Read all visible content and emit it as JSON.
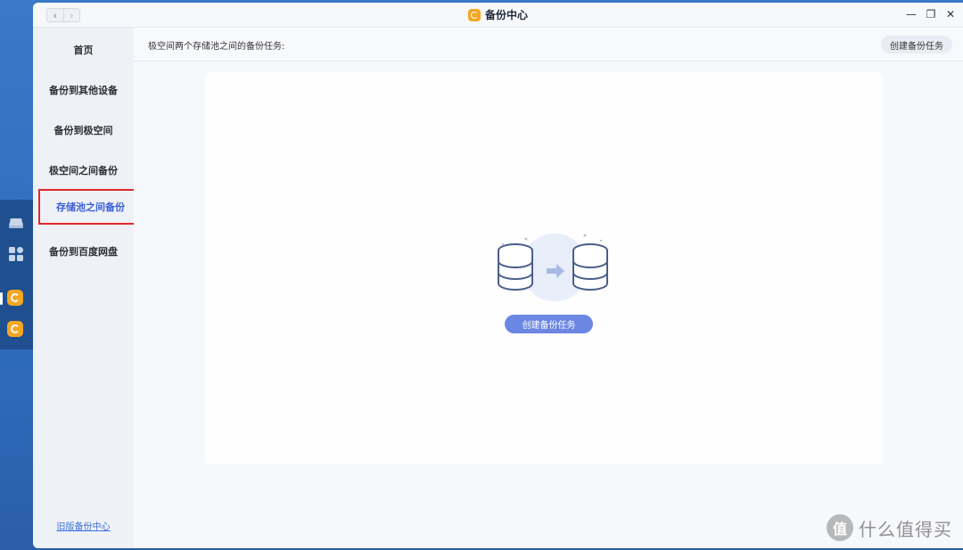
{
  "window": {
    "title": "备份中心",
    "nav_back": "‹",
    "nav_forward": "›",
    "minimize": "—",
    "restore": "❐",
    "close": "✕"
  },
  "sidebar": {
    "items": [
      {
        "label": "首页"
      },
      {
        "label": "备份到其他设备"
      },
      {
        "label": "备份到极空间"
      },
      {
        "label": "极空间之间备份"
      },
      {
        "label": "存储池之间备份"
      },
      {
        "label": "备份到百度网盘"
      }
    ],
    "active_index": 4,
    "footer_link": "旧版备份中心"
  },
  "main": {
    "description": "极空间两个存储池之间的备份任务:",
    "create_top_label": "创建备份任务",
    "create_main_label": "创建备份任务"
  },
  "watermark": {
    "badge": "值",
    "text": "什么值得买"
  },
  "colors": {
    "accent": "#6b86e3",
    "active_text": "#3a5fd9",
    "highlight_border": "#e0282e",
    "app_icon": "#f5a623"
  },
  "icons": {
    "dock": [
      "drive-icon",
      "apps-grid-icon",
      "backup-app-icon",
      "backup-app-icon"
    ],
    "illustration": "storage-pool-transfer-illustration"
  }
}
